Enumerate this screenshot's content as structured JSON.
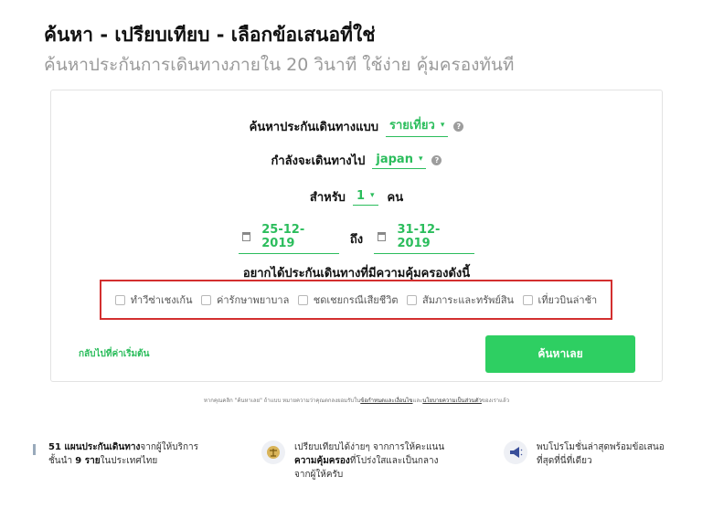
{
  "header": {
    "title": "ค้นหา - เปรียบเทียบ - เลือกข้อเสนอที่ใช่",
    "subtitle": "ค้นหาประกันการเดินทางภายใน 20 วินาที ใช้ง่าย คุ้มครองทันที"
  },
  "form": {
    "type_label": "ค้นหาประกันเดินทางแบบ",
    "type_value": "รายเที่ยว",
    "destination_label": "กำลังจะเดินทางไป",
    "destination_value": "japan",
    "persons_label": "สำหรับ",
    "persons_value": "1",
    "persons_unit": "คน",
    "date_from": "25-12-2019",
    "date_to_label": "ถึง",
    "date_to": "31-12-2019",
    "coverage_title": "อยากได้ประกันเดินทางที่มีความคุ้มครองดังนี้",
    "coverages": [
      "ทำวีซ่าเชงเก้น",
      "ค่ารักษาพยาบาล",
      "ชดเชยกรณีเสียชีวิต",
      "สัมภาระและทรัพย์สิน",
      "เที่ยวบินล่าช้า"
    ],
    "reset_label": "กลับไปที่ค่าเริ่มต้น",
    "search_button": "ค้นหาเลย"
  },
  "terms": {
    "prefix": "หากคุณคลิก \"ค้นหาเลย\" ถ้าแบบ หมายความว่าคุณตกลงยอมรับใน",
    "link1": "ข้อกำหนดและเงื่อนไข",
    "middle": "และ",
    "link2": "นโยบายความเป็นส่วนตัว",
    "suffix": "ของเราแล้ว"
  },
  "features": [
    {
      "bold": "51 แผนประกันเดินทาง",
      "rest1": "จากผู้ให้บริการ",
      "line2_pre": "ชั้นนำ ",
      "bold2": "9 ราย",
      "rest2": "ในประเทศไทย",
      "icon": "info-bar-icon"
    },
    {
      "bold": "",
      "rest1": "เปรียบเทียบได้ง่ายๆ จากการให้คะแนน",
      "line2_pre": "",
      "bold2": "ความคุ้มครอง",
      "rest2": "ที่โปร่งใสและเป็นกลาง",
      "line3": "จากผู้ให้ครับ",
      "icon": "scale-icon"
    },
    {
      "bold": "",
      "rest1": "พบโปรโมชั่นล่าสุดพร้อมข้อเสนอ",
      "line2_pre": "",
      "bold2": "",
      "rest2": "ที่สุดที่นี่ที่เดียว",
      "icon": "megaphone-icon"
    }
  ],
  "colors": {
    "accent": "#2bbd5c",
    "button": "#2ecf62",
    "highlight_border": "#d32f2f"
  }
}
